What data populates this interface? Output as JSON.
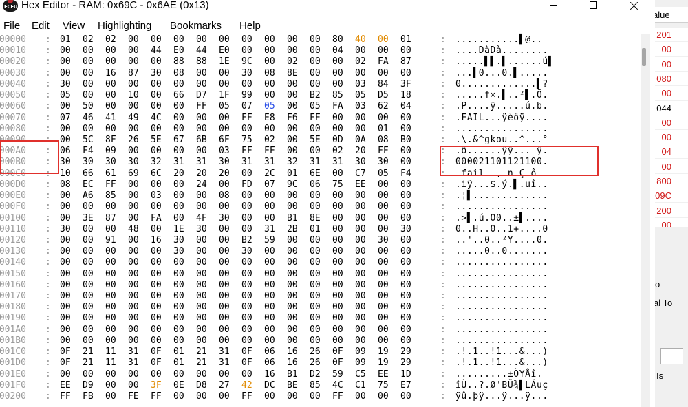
{
  "window": {
    "title": "Hex Editor - RAM: 0x69C - 0x6AE (0x13)",
    "icon_text": "FCEUX"
  },
  "menu": [
    "File",
    "Edit",
    "View",
    "Highlighting",
    "Bookmarks",
    "Help"
  ],
  "colors": {
    "address": "#9a9a9a",
    "byte": "#000000",
    "byte_orange": "#e08a00",
    "byte_blue": "#2a4fe8",
    "highlight_box": "#e0302c",
    "bg_value_red": "#d11a1a"
  },
  "rows": [
    {
      "addr": "000000",
      "bytes": [
        "01",
        "02",
        "02",
        "00",
        "00",
        "00",
        "00",
        "00",
        "00",
        "00",
        "00",
        "00",
        "80",
        "40",
        "00",
        "01"
      ],
      "ascii": "...........▌@.."
    },
    {
      "addr": "000010",
      "bytes": [
        "00",
        "00",
        "00",
        "00",
        "44",
        "E0",
        "44",
        "E0",
        "00",
        "00",
        "00",
        "00",
        "04",
        "00",
        "00",
        "00"
      ],
      "ascii": "....DàDà........"
    },
    {
      "addr": "000020",
      "bytes": [
        "00",
        "00",
        "00",
        "00",
        "00",
        "88",
        "88",
        "1E",
        "9C",
        "00",
        "02",
        "00",
        "00",
        "02",
        "FA",
        "87"
      ],
      "ascii": ".....▌▌.▌......ú▌"
    },
    {
      "addr": "000030",
      "bytes": [
        "00",
        "00",
        "16",
        "87",
        "30",
        "08",
        "00",
        "00",
        "30",
        "08",
        "8E",
        "00",
        "00",
        "00",
        "00",
        "00"
      ],
      "ascii": "...▌0...0.▌....."
    },
    {
      "addr": "000040",
      "bytes": [
        "30",
        "00",
        "00",
        "00",
        "00",
        "00",
        "00",
        "00",
        "00",
        "00",
        "00",
        "00",
        "00",
        "03",
        "84",
        "3F"
      ],
      "ascii": "0.............▌?"
    },
    {
      "addr": "000050",
      "bytes": [
        "05",
        "00",
        "00",
        "10",
        "00",
        "66",
        "D7",
        "1F",
        "99",
        "00",
        "00",
        "B2",
        "85",
        "05",
        "D5",
        "18"
      ],
      "ascii": ".....f×.▌..²▌.Õ."
    },
    {
      "addr": "000060",
      "bytes": [
        "00",
        "50",
        "00",
        "00",
        "00",
        "00",
        "FF",
        "05",
        "07",
        "05",
        "00",
        "05",
        "FA",
        "03",
        "62",
        "04"
      ],
      "ascii": ".P....ÿ.....ú.b."
    },
    {
      "addr": "000070",
      "bytes": [
        "07",
        "46",
        "41",
        "49",
        "4C",
        "00",
        "00",
        "00",
        "FF",
        "E8",
        "F6",
        "FF",
        "00",
        "00",
        "00",
        "00"
      ],
      "ascii": ".FAIL...ÿèöÿ...."
    },
    {
      "addr": "000080",
      "bytes": [
        "00",
        "00",
        "00",
        "00",
        "00",
        "00",
        "00",
        "00",
        "00",
        "00",
        "00",
        "00",
        "00",
        "00",
        "01",
        "00"
      ],
      "ascii": "................"
    },
    {
      "addr": "000090",
      "bytes": [
        "00",
        "5C",
        "8F",
        "26",
        "5E",
        "67",
        "6B",
        "6F",
        "75",
        "02",
        "00",
        "5E",
        "0D",
        "0A",
        "08",
        "B0"
      ],
      "ascii": ".\\.&^gkou..^...°"
    },
    {
      "addr": "0000A0",
      "bytes": [
        "06",
        "F4",
        "09",
        "00",
        "00",
        "00",
        "00",
        "03",
        "FF",
        "FF",
        "00",
        "00",
        "02",
        "20",
        "FF",
        "00"
      ],
      "ascii": ".ô......ÿÿ... ÿ."
    },
    {
      "addr": "0000B0",
      "bytes": [
        "30",
        "30",
        "30",
        "30",
        "32",
        "31",
        "31",
        "30",
        "31",
        "31",
        "32",
        "31",
        "31",
        "30",
        "30",
        "00"
      ],
      "ascii": "000021101121100."
    },
    {
      "addr": "0000C0",
      "bytes": [
        "10",
        "66",
        "61",
        "69",
        "6C",
        "20",
        "20",
        "20",
        "00",
        "2C",
        "01",
        "6E",
        "00",
        "C7",
        "05",
        "F4"
      ],
      "ascii": ".fail    .,.n.Ç.ô"
    },
    {
      "addr": "0000D0",
      "bytes": [
        "08",
        "EC",
        "FF",
        "00",
        "00",
        "00",
        "24",
        "00",
        "FD",
        "07",
        "9C",
        "06",
        "75",
        "EE",
        "00",
        "00"
      ],
      "ascii": ".iÿ...$.ý.▌.uî.."
    },
    {
      "addr": "0000E0",
      "bytes": [
        "00",
        "A6",
        "85",
        "00",
        "03",
        "00",
        "00",
        "08",
        "00",
        "00",
        "00",
        "00",
        "00",
        "00",
        "00",
        "00"
      ],
      "ascii": ".¦▌............."
    },
    {
      "addr": "0000F0",
      "bytes": [
        "00",
        "00",
        "00",
        "00",
        "00",
        "00",
        "00",
        "00",
        "00",
        "00",
        "00",
        "00",
        "00",
        "00",
        "00",
        "00"
      ],
      "ascii": "................"
    },
    {
      "addr": "000100",
      "bytes": [
        "00",
        "3E",
        "87",
        "00",
        "FA",
        "00",
        "4F",
        "30",
        "00",
        "00",
        "B1",
        "8E",
        "00",
        "00",
        "00",
        "00"
      ],
      "ascii": ".>▌.ú.O0..±▌...."
    },
    {
      "addr": "000110",
      "bytes": [
        "30",
        "00",
        "00",
        "48",
        "00",
        "1E",
        "30",
        "00",
        "00",
        "31",
        "2B",
        "01",
        "00",
        "00",
        "00",
        "30"
      ],
      "ascii": "0..H..0..1+....0"
    },
    {
      "addr": "000120",
      "bytes": [
        "00",
        "00",
        "91",
        "00",
        "16",
        "30",
        "00",
        "00",
        "B2",
        "59",
        "00",
        "00",
        "00",
        "00",
        "30",
        "00"
      ],
      "ascii": "..'..0..²Y....0."
    },
    {
      "addr": "000130",
      "bytes": [
        "00",
        "00",
        "00",
        "00",
        "00",
        "30",
        "00",
        "00",
        "30",
        "00",
        "00",
        "00",
        "00",
        "00",
        "00",
        "00"
      ],
      "ascii": ".....0..0......."
    },
    {
      "addr": "000140",
      "bytes": [
        "00",
        "00",
        "00",
        "00",
        "00",
        "00",
        "00",
        "00",
        "00",
        "00",
        "00",
        "00",
        "00",
        "00",
        "00",
        "00"
      ],
      "ascii": "................"
    },
    {
      "addr": "000150",
      "bytes": [
        "00",
        "00",
        "00",
        "00",
        "00",
        "00",
        "00",
        "00",
        "00",
        "00",
        "00",
        "00",
        "00",
        "00",
        "00",
        "00"
      ],
      "ascii": "................"
    },
    {
      "addr": "000160",
      "bytes": [
        "00",
        "00",
        "00",
        "00",
        "00",
        "00",
        "00",
        "00",
        "00",
        "00",
        "00",
        "00",
        "00",
        "00",
        "00",
        "00"
      ],
      "ascii": "................"
    },
    {
      "addr": "000170",
      "bytes": [
        "00",
        "00",
        "00",
        "00",
        "00",
        "00",
        "00",
        "00",
        "00",
        "00",
        "00",
        "00",
        "00",
        "00",
        "00",
        "00"
      ],
      "ascii": "................"
    },
    {
      "addr": "000180",
      "bytes": [
        "00",
        "00",
        "00",
        "00",
        "00",
        "00",
        "00",
        "00",
        "00",
        "00",
        "00",
        "00",
        "00",
        "00",
        "00",
        "00"
      ],
      "ascii": "................"
    },
    {
      "addr": "000190",
      "bytes": [
        "00",
        "00",
        "00",
        "00",
        "00",
        "00",
        "00",
        "00",
        "00",
        "00",
        "00",
        "00",
        "00",
        "00",
        "00",
        "00"
      ],
      "ascii": "................"
    },
    {
      "addr": "0001A0",
      "bytes": [
        "00",
        "00",
        "00",
        "00",
        "00",
        "00",
        "00",
        "00",
        "00",
        "00",
        "00",
        "00",
        "00",
        "00",
        "00",
        "00"
      ],
      "ascii": "................"
    },
    {
      "addr": "0001B0",
      "bytes": [
        "00",
        "00",
        "00",
        "00",
        "00",
        "00",
        "00",
        "00",
        "00",
        "00",
        "00",
        "00",
        "00",
        "00",
        "00",
        "00"
      ],
      "ascii": "................"
    },
    {
      "addr": "0001C0",
      "bytes": [
        "0F",
        "21",
        "11",
        "31",
        "0F",
        "01",
        "21",
        "31",
        "0F",
        "06",
        "16",
        "26",
        "0F",
        "09",
        "19",
        "29"
      ],
      "ascii": ".!.1..!1...&...)"
    },
    {
      "addr": "0001D0",
      "bytes": [
        "0F",
        "21",
        "11",
        "31",
        "0F",
        "01",
        "21",
        "31",
        "0F",
        "06",
        "16",
        "26",
        "0F",
        "09",
        "19",
        "29"
      ],
      "ascii": ".!.1..!1...&...)"
    },
    {
      "addr": "0001E0",
      "bytes": [
        "00",
        "00",
        "00",
        "00",
        "00",
        "00",
        "00",
        "00",
        "00",
        "16",
        "B1",
        "D2",
        "59",
        "C5",
        "EE",
        "1D"
      ],
      "ascii": ".........±ÒYÅî."
    },
    {
      "addr": "0001F0",
      "bytes": [
        "EE",
        "D9",
        "00",
        "00",
        "3F",
        "0E",
        "D8",
        "27",
        "42",
        "DC",
        "BE",
        "85",
        "4C",
        "C1",
        "75",
        "E7"
      ],
      "ascii": "îÙ..?.Ø'BÜ¾▌LÁuç"
    },
    {
      "addr": "000200",
      "bytes": [
        "FF",
        "FB",
        "00",
        "FE",
        "FF",
        "00",
        "00",
        "00",
        "FF",
        "00",
        "00",
        "00",
        "FF",
        "00",
        "00",
        "00"
      ],
      "ascii": "ÿû.þÿ...ÿ...ÿ..."
    }
  ],
  "orange_cells": [
    "000000:13",
    "000000:14",
    "0001F0:4",
    "0001F0:8"
  ],
  "blue_cells": [
    "000060:9"
  ],
  "background_panel": {
    "header": "alue",
    "values": [
      {
        "text": "201",
        "color": "#d11a1a"
      },
      {
        "text": "00",
        "color": "#d11a1a"
      },
      {
        "text": "00",
        "color": "#d11a1a"
      },
      {
        "text": "080",
        "color": "#d11a1a"
      },
      {
        "text": "00",
        "color": "#d11a1a"
      },
      {
        "text": "044",
        "color": "#000000"
      },
      {
        "text": "00",
        "color": "#d11a1a"
      },
      {
        "text": "00",
        "color": "#d11a1a"
      },
      {
        "text": "04",
        "color": "#d11a1a"
      },
      {
        "text": "00",
        "color": "#d11a1a"
      },
      {
        "text": "800",
        "color": "#d11a1a"
      },
      {
        "text": "09C",
        "color": "#d11a1a"
      },
      {
        "text": "200",
        "color": "#d11a1a"
      },
      {
        "text": "00",
        "color": "#d11a1a"
      }
    ],
    "labels": [
      "o",
      "al To",
      "Is"
    ]
  }
}
